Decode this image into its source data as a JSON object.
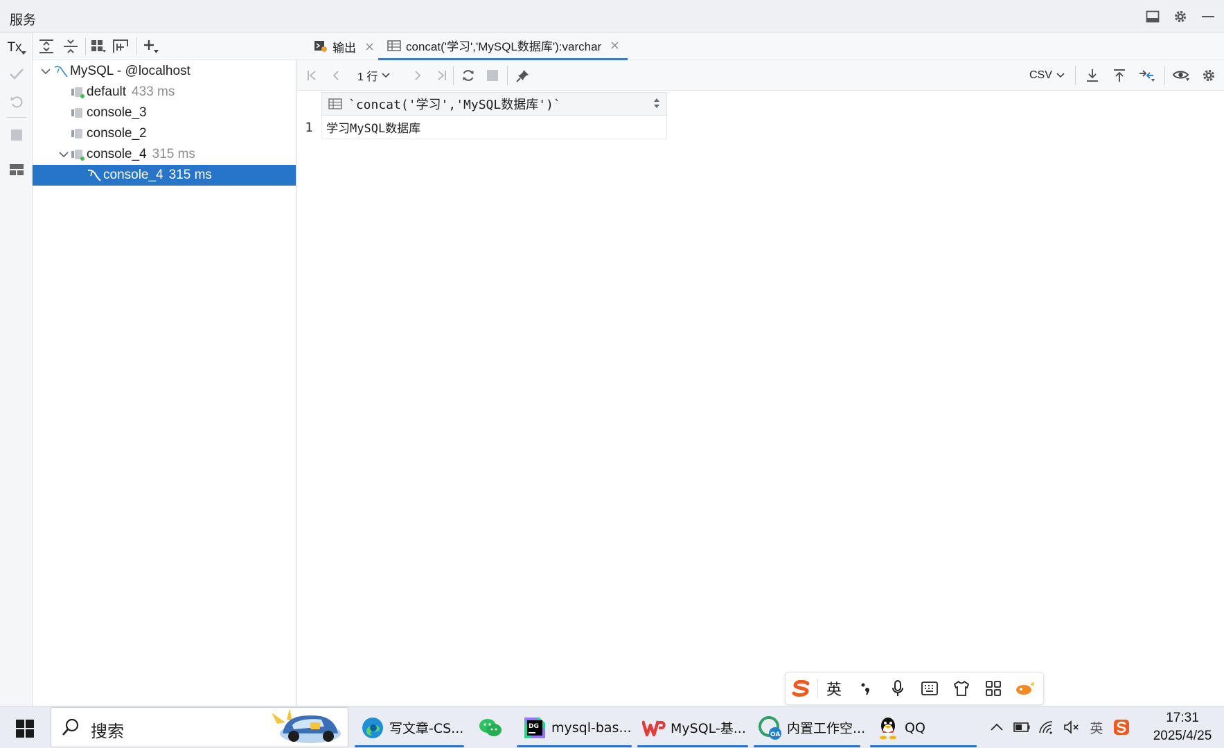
{
  "header": {
    "title": "服务"
  },
  "left_toolbar": {
    "tx_label": "Tx"
  },
  "tree": {
    "items": [
      {
        "label": "MySQL - @localhost",
        "time": ""
      },
      {
        "label": "default",
        "time": "433 ms"
      },
      {
        "label": "console_3",
        "time": ""
      },
      {
        "label": "console_2",
        "time": ""
      },
      {
        "label": "console_4",
        "time": "315 ms"
      },
      {
        "label": "console_4",
        "time": "315 ms"
      }
    ]
  },
  "tabs": [
    {
      "label": "输出"
    },
    {
      "label": "concat('学习','MySQL数据库'):varchar"
    }
  ],
  "result_toolbar": {
    "rows_label": "1 行",
    "export_format": "CSV"
  },
  "grid": {
    "columns": [
      "`concat('学习','MySQL数据库')`"
    ],
    "rows": [
      {
        "num": "1",
        "cells": [
          "学习MySQL数据库"
        ]
      }
    ]
  },
  "ime": {
    "lang": "英"
  },
  "taskbar": {
    "search_placeholder": "搜索",
    "apps": [
      {
        "label": "写文章-CS..."
      },
      {
        "label": ""
      },
      {
        "label": "mysql-bas..."
      },
      {
        "label": "MySQL-基..."
      },
      {
        "label": "内置工作空..."
      },
      {
        "label": "QQ"
      }
    ],
    "tray_lang": "英",
    "time": "17:31",
    "date": "2025/4/25"
  },
  "colors": {
    "selection": "#2675c9",
    "accent": "#4078c0",
    "taskbar": "#e9edf3"
  }
}
